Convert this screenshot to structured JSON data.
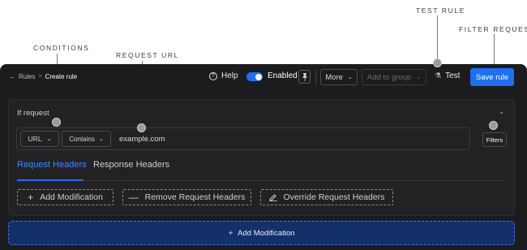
{
  "callouts": {
    "test_rule": "TEST RULE",
    "filter_requests": "FILTER REQUESTS",
    "conditions": "CONDITIONS",
    "request_url": "REQUEST URL"
  },
  "breadcrumb": {
    "root": "Rules",
    "separator": ">",
    "current": "Create rule"
  },
  "toolbar": {
    "help_label": "Help",
    "help_icon": "?",
    "enabled_label": "Enabled",
    "enabled": true,
    "pin_icon": "pin-icon",
    "more_label": "More",
    "add_to_group_label": "Add to group",
    "test_label": "Test",
    "save_label": "Save rule"
  },
  "rule": {
    "if_label": "If request",
    "source_type": "URL",
    "operator": "Contains",
    "url_value": "example.com",
    "filters_label": "Filters"
  },
  "tabs": [
    {
      "label": "Request Headers",
      "active": true
    },
    {
      "label": "Response Headers",
      "active": false
    }
  ],
  "modifications": {
    "add_label": "Add Modification",
    "remove_label": "Remove Request Headers",
    "override_label": "Override Request Headers"
  },
  "bottom": {
    "add_label": "Add Modification"
  },
  "colors": {
    "accent": "#1f6ff2",
    "background": "#1c1c1e",
    "active_tab": "#3b8cff"
  }
}
